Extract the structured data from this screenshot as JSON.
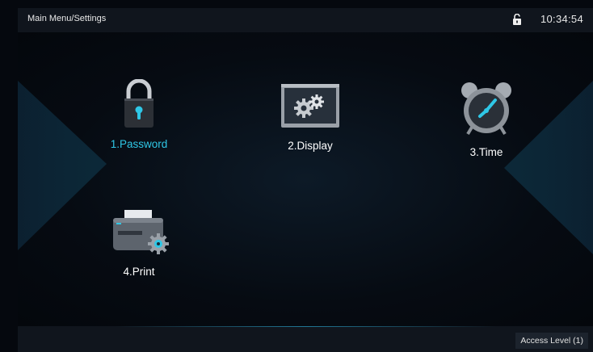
{
  "header": {
    "title": "Main Menu/Settings",
    "lock_icon": "unlocked-padlock-icon",
    "time": "10:34:54"
  },
  "menu": {
    "items": [
      {
        "label": "1.Password",
        "icon": "padlock-icon",
        "selected": true
      },
      {
        "label": "2.Display",
        "icon": "display-gears-icon",
        "selected": false
      },
      {
        "label": "3.Time",
        "icon": "alarm-clock-icon",
        "selected": false
      },
      {
        "label": "4.Print",
        "icon": "printer-gear-icon",
        "selected": false
      }
    ]
  },
  "footer": {
    "access_level": "Access Level  (1)"
  },
  "colors": {
    "accent": "#2fc7e6",
    "background": "#05080e",
    "bar": "#10151d"
  }
}
